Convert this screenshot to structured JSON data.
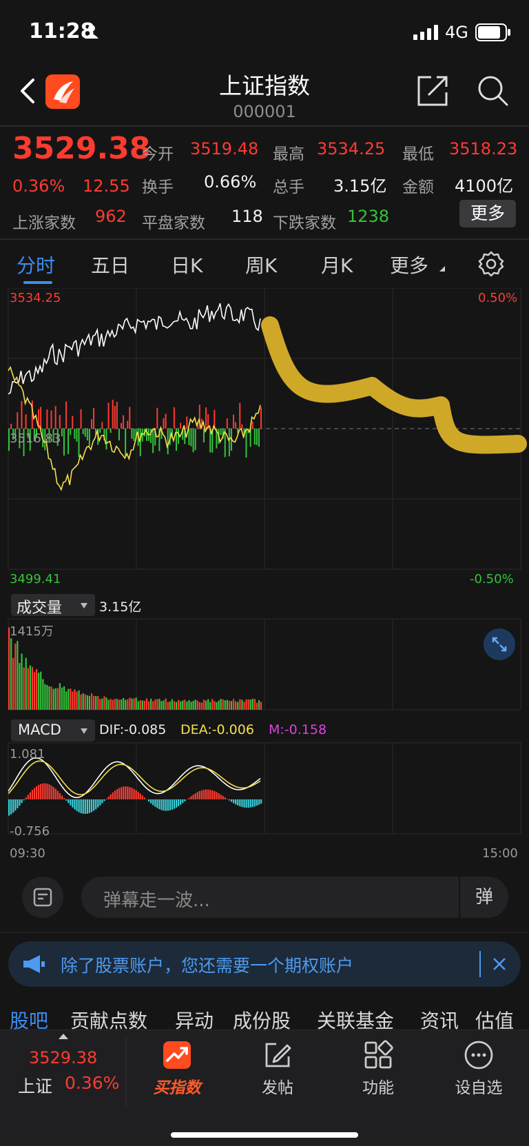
{
  "status": {
    "time": "11:28",
    "network": "4G"
  },
  "nav": {
    "title": "上证指数",
    "code": "000001"
  },
  "quote": {
    "price": "3529.38",
    "change_pct": "0.36%",
    "change": "12.55",
    "open_label": "今开",
    "open": "3519.48",
    "high_label": "最高",
    "high": "3534.25",
    "low_label": "最低",
    "low": "3518.23",
    "turnover_label": "换手",
    "turnover": "0.66%",
    "volume_label": "总手",
    "volume": "3.15亿",
    "amount_label": "金额",
    "amount": "4100亿",
    "up_label": "上涨家数",
    "up": "962",
    "flat_label": "平盘家数",
    "flat": "118",
    "down_label": "下跌家数",
    "down": "1238",
    "more": "更多"
  },
  "tabs": [
    "分时",
    "五日",
    "日K",
    "周K",
    "月K",
    "更多"
  ],
  "chart": {
    "top_price": "3534.25",
    "top_pct": "0.50%",
    "mid_price": "3516.83",
    "bottom_price": "3499.41",
    "bottom_pct": "-0.50%",
    "vol_label": "成交量",
    "vol_total": "3.15亿",
    "vol_max": "1415万",
    "macd_label": "MACD",
    "dif": "DIF:-0.085",
    "dea": "DEA:-0.006",
    "m": "M:-0.158",
    "macd_top": "1.081",
    "macd_bottom": "-0.756",
    "time_start": "09:30",
    "time_end": "15:00",
    "colors": {
      "up": "#ff3b30",
      "down": "#35c43a",
      "price_line": "#ffffff",
      "avg_line": "#f5e04a",
      "macd_neg": "#3ad0d8",
      "dea": "#f5e04a",
      "m": "#e040e0"
    }
  },
  "danmu": {
    "placeholder": "弹幕走一波...",
    "send": "弹"
  },
  "banner": {
    "text": "除了股票账户，您还需要一个期权账户"
  },
  "sections": [
    "股吧",
    "贡献点数",
    "异动",
    "成份股",
    "关联基金",
    "资讯",
    "估值"
  ],
  "bottom": {
    "index_price": "3529.38",
    "index_name": "上证",
    "index_pct": "0.36%",
    "buy": "买指数",
    "post": "发帖",
    "func": "功能",
    "watch": "设自选"
  }
}
